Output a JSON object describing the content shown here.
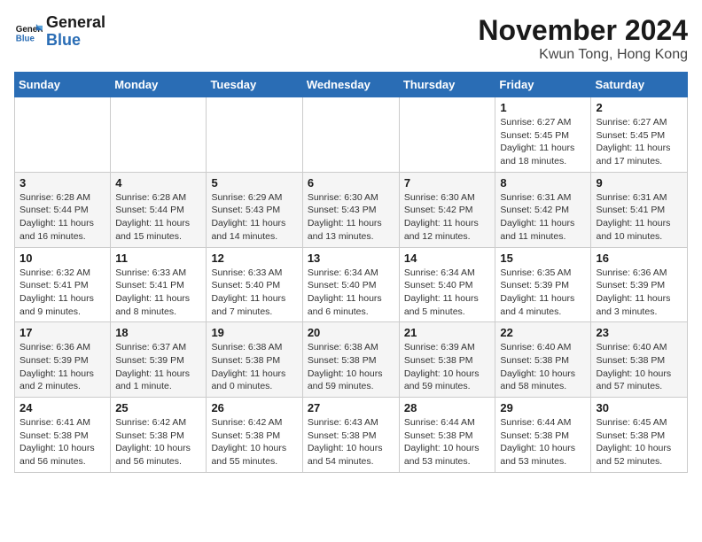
{
  "header": {
    "logo_general": "General",
    "logo_blue": "Blue",
    "month_title": "November 2024",
    "location": "Kwun Tong, Hong Kong"
  },
  "columns": [
    "Sunday",
    "Monday",
    "Tuesday",
    "Wednesday",
    "Thursday",
    "Friday",
    "Saturday"
  ],
  "weeks": [
    [
      {
        "day": "",
        "detail": ""
      },
      {
        "day": "",
        "detail": ""
      },
      {
        "day": "",
        "detail": ""
      },
      {
        "day": "",
        "detail": ""
      },
      {
        "day": "",
        "detail": ""
      },
      {
        "day": "1",
        "detail": "Sunrise: 6:27 AM\nSunset: 5:45 PM\nDaylight: 11 hours and 18 minutes."
      },
      {
        "day": "2",
        "detail": "Sunrise: 6:27 AM\nSunset: 5:45 PM\nDaylight: 11 hours and 17 minutes."
      }
    ],
    [
      {
        "day": "3",
        "detail": "Sunrise: 6:28 AM\nSunset: 5:44 PM\nDaylight: 11 hours and 16 minutes."
      },
      {
        "day": "4",
        "detail": "Sunrise: 6:28 AM\nSunset: 5:44 PM\nDaylight: 11 hours and 15 minutes."
      },
      {
        "day": "5",
        "detail": "Sunrise: 6:29 AM\nSunset: 5:43 PM\nDaylight: 11 hours and 14 minutes."
      },
      {
        "day": "6",
        "detail": "Sunrise: 6:30 AM\nSunset: 5:43 PM\nDaylight: 11 hours and 13 minutes."
      },
      {
        "day": "7",
        "detail": "Sunrise: 6:30 AM\nSunset: 5:42 PM\nDaylight: 11 hours and 12 minutes."
      },
      {
        "day": "8",
        "detail": "Sunrise: 6:31 AM\nSunset: 5:42 PM\nDaylight: 11 hours and 11 minutes."
      },
      {
        "day": "9",
        "detail": "Sunrise: 6:31 AM\nSunset: 5:41 PM\nDaylight: 11 hours and 10 minutes."
      }
    ],
    [
      {
        "day": "10",
        "detail": "Sunrise: 6:32 AM\nSunset: 5:41 PM\nDaylight: 11 hours and 9 minutes."
      },
      {
        "day": "11",
        "detail": "Sunrise: 6:33 AM\nSunset: 5:41 PM\nDaylight: 11 hours and 8 minutes."
      },
      {
        "day": "12",
        "detail": "Sunrise: 6:33 AM\nSunset: 5:40 PM\nDaylight: 11 hours and 7 minutes."
      },
      {
        "day": "13",
        "detail": "Sunrise: 6:34 AM\nSunset: 5:40 PM\nDaylight: 11 hours and 6 minutes."
      },
      {
        "day": "14",
        "detail": "Sunrise: 6:34 AM\nSunset: 5:40 PM\nDaylight: 11 hours and 5 minutes."
      },
      {
        "day": "15",
        "detail": "Sunrise: 6:35 AM\nSunset: 5:39 PM\nDaylight: 11 hours and 4 minutes."
      },
      {
        "day": "16",
        "detail": "Sunrise: 6:36 AM\nSunset: 5:39 PM\nDaylight: 11 hours and 3 minutes."
      }
    ],
    [
      {
        "day": "17",
        "detail": "Sunrise: 6:36 AM\nSunset: 5:39 PM\nDaylight: 11 hours and 2 minutes."
      },
      {
        "day": "18",
        "detail": "Sunrise: 6:37 AM\nSunset: 5:39 PM\nDaylight: 11 hours and 1 minute."
      },
      {
        "day": "19",
        "detail": "Sunrise: 6:38 AM\nSunset: 5:38 PM\nDaylight: 11 hours and 0 minutes."
      },
      {
        "day": "20",
        "detail": "Sunrise: 6:38 AM\nSunset: 5:38 PM\nDaylight: 10 hours and 59 minutes."
      },
      {
        "day": "21",
        "detail": "Sunrise: 6:39 AM\nSunset: 5:38 PM\nDaylight: 10 hours and 59 minutes."
      },
      {
        "day": "22",
        "detail": "Sunrise: 6:40 AM\nSunset: 5:38 PM\nDaylight: 10 hours and 58 minutes."
      },
      {
        "day": "23",
        "detail": "Sunrise: 6:40 AM\nSunset: 5:38 PM\nDaylight: 10 hours and 57 minutes."
      }
    ],
    [
      {
        "day": "24",
        "detail": "Sunrise: 6:41 AM\nSunset: 5:38 PM\nDaylight: 10 hours and 56 minutes."
      },
      {
        "day": "25",
        "detail": "Sunrise: 6:42 AM\nSunset: 5:38 PM\nDaylight: 10 hours and 56 minutes."
      },
      {
        "day": "26",
        "detail": "Sunrise: 6:42 AM\nSunset: 5:38 PM\nDaylight: 10 hours and 55 minutes."
      },
      {
        "day": "27",
        "detail": "Sunrise: 6:43 AM\nSunset: 5:38 PM\nDaylight: 10 hours and 54 minutes."
      },
      {
        "day": "28",
        "detail": "Sunrise: 6:44 AM\nSunset: 5:38 PM\nDaylight: 10 hours and 53 minutes."
      },
      {
        "day": "29",
        "detail": "Sunrise: 6:44 AM\nSunset: 5:38 PM\nDaylight: 10 hours and 53 minutes."
      },
      {
        "day": "30",
        "detail": "Sunrise: 6:45 AM\nSunset: 5:38 PM\nDaylight: 10 hours and 52 minutes."
      }
    ]
  ]
}
